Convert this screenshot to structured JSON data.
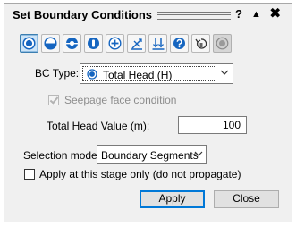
{
  "window": {
    "title": "Set Boundary Conditions",
    "help_label": "?",
    "collapse_label": "▲",
    "close_label": "✖"
  },
  "toolbar": {
    "tools": [
      {
        "name": "total-head-icon",
        "state": "selected"
      },
      {
        "name": "pressure-head-icon",
        "state": "normal"
      },
      {
        "name": "seepage-face-icon",
        "state": "normal"
      },
      {
        "name": "unknown-boundary-icon",
        "state": "normal"
      },
      {
        "name": "nodal-flow-icon",
        "state": "normal"
      },
      {
        "name": "infiltration-icon",
        "state": "normal"
      },
      {
        "name": "drainage-icon",
        "state": "normal"
      },
      {
        "name": "custom-boundary-icon",
        "state": "normal"
      },
      {
        "name": "reset-boundary-icon",
        "state": "normal"
      },
      {
        "name": "disabled-tool-icon",
        "state": "disabled"
      }
    ]
  },
  "bc_type": {
    "label": "BC Type:",
    "selected": "Total Head (H)"
  },
  "seepage_face": {
    "label": "Seepage face condition",
    "checked": true,
    "enabled": false
  },
  "total_head": {
    "label": "Total Head Value (m):",
    "value": "100"
  },
  "selection_mode": {
    "label": "Selection mode:",
    "selected": "Boundary Segments"
  },
  "apply_stage": {
    "label": "Apply at this stage only (do not propagate)",
    "checked": false
  },
  "buttons": {
    "apply": "Apply",
    "close": "Close"
  },
  "colors": {
    "dialog_bg": "#f0f0f0",
    "icon_blue": "#1565c0",
    "selected_bg": "#cce4f7",
    "focus_border": "#0078d7"
  }
}
